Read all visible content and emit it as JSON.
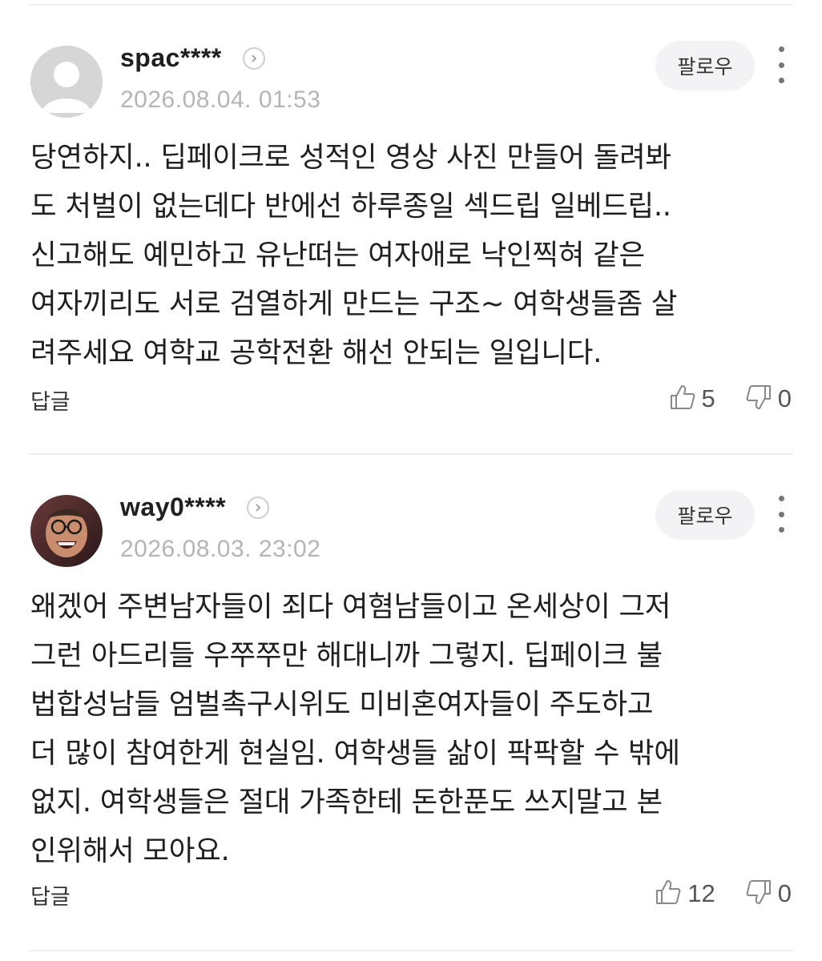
{
  "comments": [
    {
      "username": "spac****",
      "timestamp": "2026.08.04. 01:53",
      "follow_label": "팔로우",
      "body_lines": [
        "당연하지.. 딥페이크로 성적인 영상 사진 만들어 돌려봐",
        "도 처벌이 없는데다 반에선 하루종일 섹드립 일베드립..",
        "신고해도 예민하고 유난떠는 여자애로 낙인찍혀 같은",
        "여자끼리도 서로 검열하게 만드는 구조~ 여학생들좀 살",
        "려주세요 여학교 공학전환 해선 안되는 일입니다."
      ],
      "reply_label": "답글",
      "likes": "5",
      "dislikes": "0",
      "avatar_icon": "default-user-avatar-icon"
    },
    {
      "username": "way0****",
      "timestamp": "2026.08.03. 23:02",
      "follow_label": "팔로우",
      "body_lines": [
        "왜겠어 주변남자들이 죄다 여혐남들이고 온세상이 그저",
        "그런 아드리들 우쭈쭈만 해대니까 그렇지. 딥페이크 불",
        "법합성남들 엄벌촉구시위도 미비혼여자들이 주도하고",
        "더 많이 참여한게 현실임. 여학생들 삶이 팍팍할 수 밖에",
        "없지. 여학생들은 절대 가족한테 돈한푼도 쓰지말고 본",
        "인위해서 모아요."
      ],
      "reply_label": "답글",
      "likes": "12",
      "dislikes": "0",
      "avatar_icon": "profile-photo-avatar"
    }
  ],
  "colors": {
    "text": "#1f1f1f",
    "muted": "#b5b5b5",
    "follow_bg": "#f3f3f5",
    "divider": "#eeeeee"
  }
}
